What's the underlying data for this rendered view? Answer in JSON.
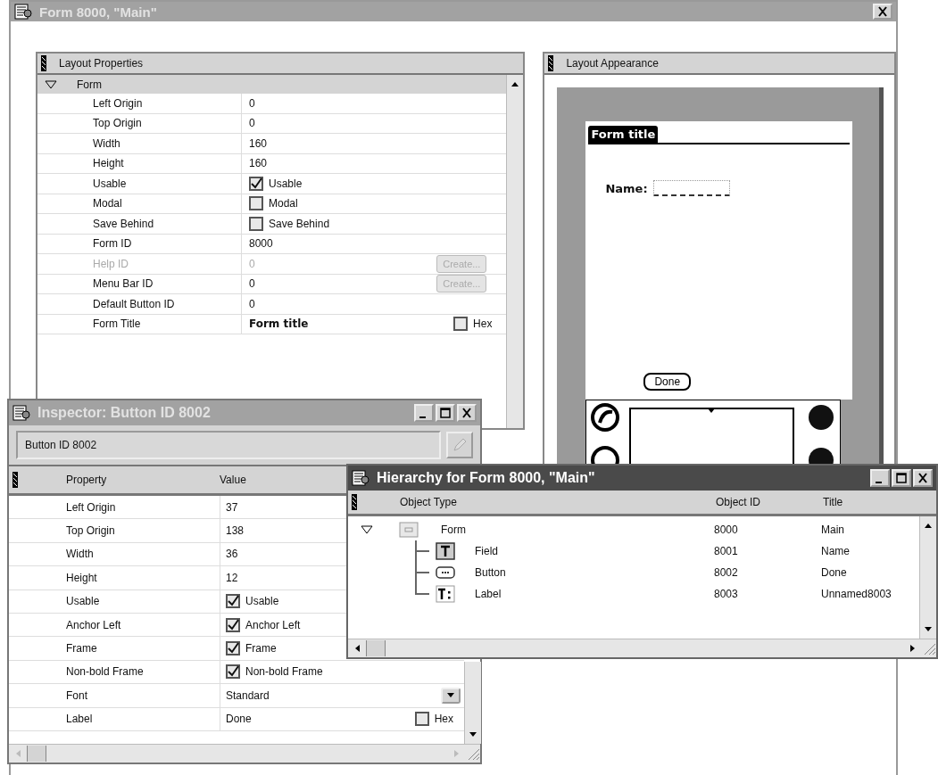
{
  "main_window": {
    "title": "Form 8000, \"Main\""
  },
  "layout_properties": {
    "title": "Layout Properties",
    "section": {
      "label": "Form",
      "expanded": true
    },
    "rows": [
      {
        "kind": "text",
        "label": "Left Origin",
        "value": "0",
        "disabled": false
      },
      {
        "kind": "text",
        "label": "Top Origin",
        "value": "0",
        "disabled": false
      },
      {
        "kind": "text",
        "label": "Width",
        "value": "160",
        "disabled": false
      },
      {
        "kind": "text",
        "label": "Height",
        "value": "160",
        "disabled": false
      },
      {
        "kind": "check",
        "label": "Usable",
        "value": "Usable",
        "checked": true,
        "disabled": false
      },
      {
        "kind": "check",
        "label": "Modal",
        "value": "Modal",
        "checked": false,
        "disabled": false
      },
      {
        "kind": "check",
        "label": "Save Behind",
        "value": "Save Behind",
        "checked": false,
        "disabled": false
      },
      {
        "kind": "text",
        "label": "Form ID",
        "value": "8000",
        "disabled": false
      },
      {
        "kind": "text",
        "label": "Help ID",
        "value": "0",
        "disabled": true,
        "button": {
          "label": "Create...",
          "disabled": true
        }
      },
      {
        "kind": "text",
        "label": "Menu Bar ID",
        "value": "0",
        "disabled": false,
        "button": {
          "label": "Create...",
          "disabled": true
        }
      },
      {
        "kind": "text",
        "label": "Default Button ID",
        "value": "0",
        "disabled": false
      },
      {
        "kind": "bold",
        "label": "Form Title",
        "value": "Form title",
        "disabled": false,
        "hex": {
          "label": "Hex",
          "checked": false
        }
      }
    ]
  },
  "layout_appearance": {
    "title": "Layout Appearance",
    "form_title": "Form title",
    "field_label": "Name:",
    "button_label": "Done"
  },
  "inspector": {
    "title": "Inspector: Button ID 8002",
    "object": "Button ID 8002",
    "columns": [
      "Property",
      "Value"
    ],
    "rows": [
      {
        "kind": "text",
        "label": "Left Origin",
        "value": "37"
      },
      {
        "kind": "text",
        "label": "Top Origin",
        "value": "138"
      },
      {
        "kind": "text",
        "label": "Width",
        "value": "36"
      },
      {
        "kind": "text",
        "label": "Height",
        "value": "12"
      },
      {
        "kind": "check",
        "label": "Usable",
        "value": "Usable",
        "checked": true
      },
      {
        "kind": "check",
        "label": "Anchor Left",
        "value": "Anchor Left",
        "checked": true
      },
      {
        "kind": "check",
        "label": "Frame",
        "value": "Frame",
        "checked": true
      },
      {
        "kind": "check",
        "label": "Non-bold Frame",
        "value": "Non-bold Frame",
        "checked": true
      },
      {
        "kind": "dropdown",
        "label": "Font",
        "value": "Standard"
      },
      {
        "kind": "text",
        "label": "Label",
        "value": "Done",
        "hex": {
          "label": "Hex",
          "checked": false
        }
      }
    ]
  },
  "hierarchy": {
    "title": "Hierarchy for Form 8000, \"Main\"",
    "columns": [
      "Object Type",
      "Object ID",
      "Title"
    ],
    "tree": [
      {
        "kind": "form",
        "type": "Form",
        "id": "8000",
        "title": "Main",
        "expanded": true,
        "children": [
          {
            "kind": "field",
            "type": "Field",
            "id": "8001",
            "title": "Name"
          },
          {
            "kind": "button",
            "type": "Button",
            "id": "8002",
            "title": "Done"
          },
          {
            "kind": "label",
            "type": "Label",
            "id": "8003",
            "title": "Unnamed8003"
          }
        ]
      }
    ]
  }
}
